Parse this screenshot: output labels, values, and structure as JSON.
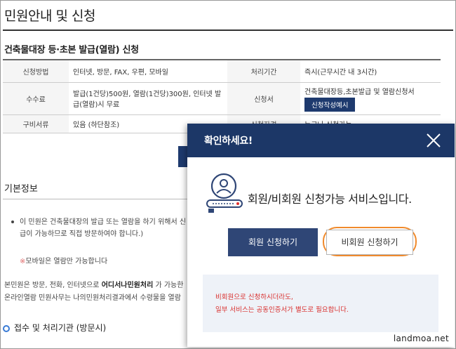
{
  "page": {
    "title": "민원안내 및 신청"
  },
  "service": {
    "heading": "건축물대장 등·초본 발급(열람) 신청",
    "rows": [
      {
        "label1": "신청방법",
        "value1": "인터넷, 방문, FAX, 우편, 모바일",
        "label2": "처리기간",
        "value2": "즉시(근무시간 내 3시간)"
      },
      {
        "label1": "수수료",
        "value1": "발급(1건당)500원, 열람(1건당)300원, 인터넷 발급(열람)시 무료",
        "label2": "신청서",
        "value2": "건축물대장등,초본발급 및 열람신청서",
        "button": "신청작성예시"
      },
      {
        "label1": "구비서류",
        "value1": "있음 (하단참조)",
        "label2": "신청자격",
        "value2": "누구나 신청가능"
      }
    ]
  },
  "basic_info": {
    "heading": "기본정보",
    "bullet": "이 민원은 건축물대장의 발급 또는 열람을 하기 위해서 신 급이 가능하므로 직접 방문하여야 합니다.)",
    "mobile_note_mark": "※",
    "mobile_note": "모바일은 열람만 가능합니다",
    "visit_line1_pre": "본민원은 방문, 전화, 인터넷으로 ",
    "visit_line1_bold": "어디서나민원처리",
    "visit_line1_post": " 가 가능한",
    "visit_line2": "온라인열람 민원사무는 나의민원처리결과에서 수령물을 열람"
  },
  "agency": {
    "heading": "접수 및 처리기관 (방문시)"
  },
  "modal": {
    "title": "확인하세요!",
    "message": "회원/비회원 신청가능 서비스입니다.",
    "member_button": "회원 신청하기",
    "guest_button": "비회원 신청하기",
    "notice_line1": "비회원으로 신청하시더라도,",
    "notice_line2": "일부 서비스는 공동인증서가 별도로 필요합니다."
  },
  "watermark": "landmoa.net",
  "colors": {
    "modal_header": "#1c3767",
    "member_button": "#2f4676",
    "highlight": "#f08a2c",
    "notice_text": "#d9302e"
  },
  "icons": [
    "close-icon",
    "member-key-icon"
  ]
}
